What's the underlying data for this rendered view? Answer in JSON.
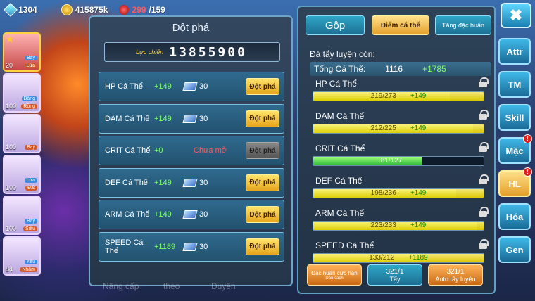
{
  "topbar": {
    "gems": "1304",
    "gold": "415875k",
    "hp_cur": "299",
    "hp_max": "/159"
  },
  "party": [
    {
      "level": "20",
      "tag1": "Bay",
      "tag2": "Lửa",
      "selected": true
    },
    {
      "level": "100",
      "tag1": "Băng",
      "tag2": "Rồng",
      "selected": false
    },
    {
      "level": "100",
      "tag1": "Bay",
      "tag2": "",
      "selected": false
    },
    {
      "level": "100",
      "tag1": "Lửa",
      "tag2": "Đất",
      "selected": false
    },
    {
      "level": "100",
      "tag1": "Bay",
      "tag2": "Siêu",
      "selected": false
    },
    {
      "level": "84",
      "tag1": "Yêu",
      "tag2": "Nhãm",
      "selected": false
    }
  ],
  "middle": {
    "title": "Đột phá",
    "power_label": "Lực chiến",
    "power_value": "13855900",
    "break_label": "Đột phá",
    "rows": [
      {
        "name": "HP Cá Thể",
        "plus": "+149",
        "cost": "30",
        "note": ""
      },
      {
        "name": "DAM Cá Thể",
        "plus": "+149",
        "cost": "30",
        "note": ""
      },
      {
        "name": "CRIT Cá Thể",
        "plus": "+0",
        "cost": "",
        "note": "Chưa mở"
      },
      {
        "name": "DEF Cá Thể",
        "plus": "+149",
        "cost": "30",
        "note": ""
      },
      {
        "name": "ARM Cá Thể",
        "plus": "+149",
        "cost": "30",
        "note": ""
      },
      {
        "name": "SPEED Cá Thể",
        "plus": "+1189",
        "cost": "30",
        "note": ""
      }
    ],
    "bottom_tabs": [
      "Nâng cấp",
      "theo",
      "Duyên"
    ]
  },
  "right": {
    "tabs": {
      "gop": "Gộp",
      "diem": "Điểm cá thể",
      "tang": "Tăng đặc huấn"
    },
    "remain_label": "Đá tẩy luyện còn:",
    "total_label": "Tổng Cá Thể:",
    "total_value": "1116",
    "total_plus": "+1785",
    "stats": [
      {
        "name": "HP Cá Thể",
        "cur": "219/273",
        "plus": "+149",
        "ratio": 0.8
      },
      {
        "name": "DAM Cá Thể",
        "cur": "212/225",
        "plus": "+149",
        "ratio": 0.94
      },
      {
        "name": "CRIT Cá Thể",
        "cur": "81/127",
        "plus": "",
        "ratio": 0.64
      },
      {
        "name": "DEF Cá Thể",
        "cur": "198/236",
        "plus": "+149",
        "ratio": 0.84
      },
      {
        "name": "ARM Cá Thể",
        "cur": "223/233",
        "plus": "+149",
        "ratio": 0.96
      },
      {
        "name": "SPEED Cá Thể",
        "cur": "133/212",
        "plus": "+1189",
        "ratio": 0.63
      }
    ],
    "btn_special": "Đặc huấn cực hạn",
    "btn_special_sub": "Dầu cách",
    "btn_wash_count": "321/1",
    "btn_wash": "Tẩy",
    "btn_auto_count": "321/1",
    "btn_auto": "Auto tẩy luyện"
  },
  "side": [
    {
      "label": "Attr",
      "badge": false,
      "hl": false
    },
    {
      "label": "TM",
      "badge": false,
      "hl": false
    },
    {
      "label": "Skill",
      "badge": false,
      "hl": false
    },
    {
      "label": "Mặc",
      "badge": true,
      "hl": false
    },
    {
      "label": "HL",
      "badge": true,
      "hl": true
    },
    {
      "label": "Hóa",
      "badge": false,
      "hl": false
    },
    {
      "label": "Gen",
      "badge": false,
      "hl": false
    }
  ],
  "badge_text": "!",
  "close_symbol": "✖"
}
